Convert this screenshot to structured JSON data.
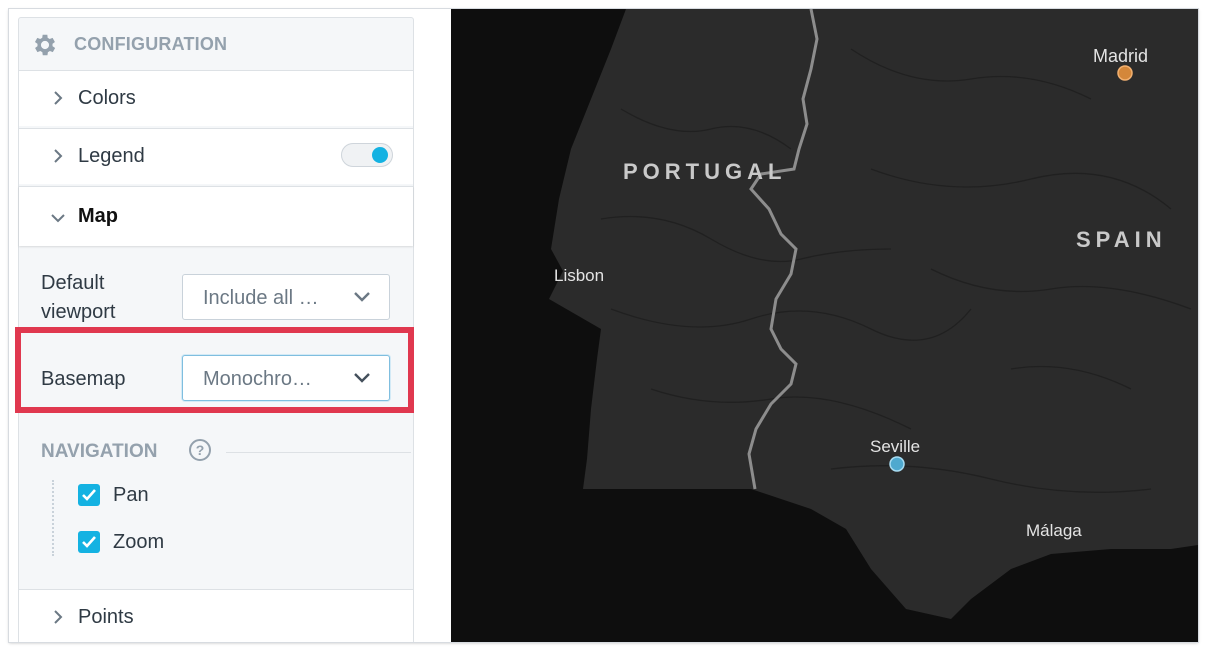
{
  "panel": {
    "title": "CONFIGURATION",
    "sections": {
      "colors": {
        "label": "Colors"
      },
      "legend": {
        "label": "Legend",
        "toggle_on": true
      },
      "map": {
        "label": "Map"
      },
      "points": {
        "label": "Points"
      }
    },
    "default_viewport": {
      "label_line1": "Default",
      "label_line2": "viewport",
      "value": "Include all …"
    },
    "basemap": {
      "label": "Basemap",
      "value": "Monochro…"
    },
    "navigation": {
      "title": "NAVIGATION",
      "help": "?",
      "options": [
        {
          "label": "Pan",
          "checked": true
        },
        {
          "label": "Zoom",
          "checked": true
        }
      ]
    }
  },
  "map": {
    "countries": [
      "PORTUGAL",
      "SPAIN"
    ],
    "cities": [
      "Madrid",
      "Lisbon",
      "Seville",
      "Málaga"
    ],
    "colors": {
      "background": "#2b2b2b",
      "land": "#3a3a3a",
      "sea": "#0e0e0e",
      "border": "#8d8d8d",
      "madrid_point": "#d4873a",
      "seville_point": "#4fa9cf"
    }
  },
  "colors": {
    "accent": "#14b2e2",
    "highlight_box": "#e0384f",
    "muted_text": "#94a1ad"
  },
  "icons": {
    "config": "gear-icon",
    "collapsed": "chevron-right-icon",
    "expanded": "chevron-down-icon",
    "select": "caret-down-icon",
    "help": "question-circle-icon",
    "check": "checkmark-icon"
  }
}
